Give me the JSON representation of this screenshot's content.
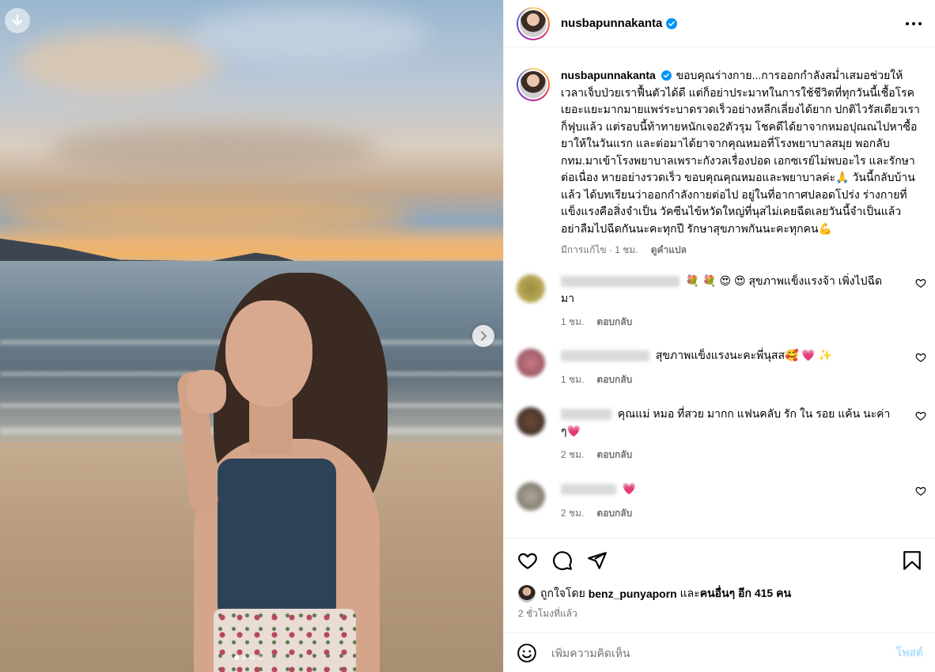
{
  "post": {
    "username": "nusbapunnakanta",
    "caption": "ขอบคุณร่างกาย...การออกกำลังสม่ำเสมอช่วยให้เวลาเจ็บป่วยเราฟื้นตัวได้ดี แต่ก็อย่าประมาทในการใช้ชีวิตที่ทุกวันนี้เชื้อโรคเยอะแยะมากมายแพร่ระบาดรวดเร็วอย่างหลีกเลี่ยงได้ยาก ปกติไวรัสเดียวเราก็ฟุบแล้ว แต่รอบนี้ท้าทายหนักเจอ2ตัวรุม โชคดีได้ยาจากหมอปุณณไปหาซื้อยาให้ในวันแรก และต่อมาได้ยาจากคุณหมอที่โรงพยาบาลสมุย พอกลับ กทม.มาเข้าโรงพยาบาลเพราะกังวลเรื่องปอด เอกซเรย์ไม่พบอะไร และรักษาต่อเนื่อง หายอย่างรวดเร็ว ขอบคุณคุณหมอและพยาบาลค่ะ🙏 วันนี้กลับบ้านแล้ว ได้บทเรียนว่าออกกำลังกายต่อไป อยู่ในที่อากาศปลอดโปร่ง ร่างกายที่แข็งแรงคือสิ่งจำเป็น วัคซีนไข้หวัดใหญ่ที่นุสไม่เคยฉีดเลยวันนี้จำเป็นแล้ว อย่าลืมไปฉีดกันนะคะทุกปี รักษาสุขภาพกันนะคะทุกคน💪",
    "edited": "มีการแก้ไข",
    "time": "1 ชม.",
    "see_translation": "ดูคำแปล"
  },
  "comments": [
    {
      "text": "💐 💐 😍 😍 สุขภาพแข็งแรงจ้า เพิ่งไปฉีดมา",
      "time": "1 ชม.",
      "reply": "ตอบกลับ"
    },
    {
      "text": "สุขภาพแข็งแรงนะคะพี่นุสส🥰 💗 ✨",
      "time": "1 ชม.",
      "reply": "ตอบกลับ"
    },
    {
      "text": "คุณแม่ หมอ ที่สวย มากก แฟนคลับ รัก ใน รอย แค้น นะค่า ๆ💗",
      "time": "2 ชม.",
      "reply": "ตอบกลับ"
    },
    {
      "text": "💗",
      "time": "2 ชม.",
      "reply": "ตอบกลับ"
    }
  ],
  "likes": {
    "prefix": "ถูกใจโดย",
    "user": "benz_punyaporn",
    "and": "และ",
    "others": "คนอื่นๆ อีก 415 คน"
  },
  "posted_ago": "2 ชั่วโมงที่แล้ว",
  "comment_box": {
    "placeholder": "เพิ่มความคิดเห็น",
    "post_label": "โพสต์"
  },
  "carousel": {
    "slide": 1,
    "slides": 4
  },
  "colors": {
    "verified": "#0095f6",
    "post_disabled": "#b2dffc",
    "meta": "#737373"
  }
}
